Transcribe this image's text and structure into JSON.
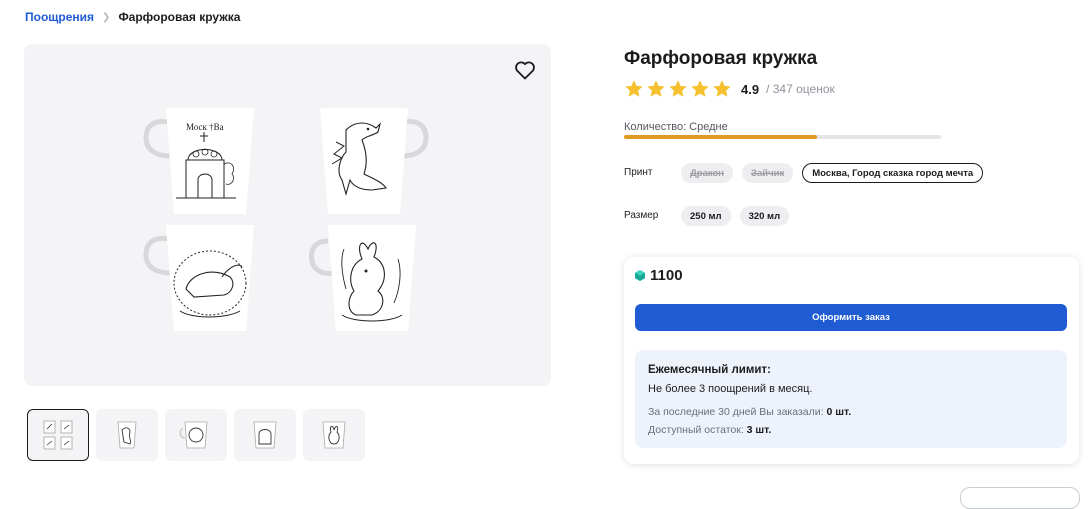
{
  "breadcrumb": {
    "parent": "Поощрения",
    "current": "Фарфоровая кружка"
  },
  "product": {
    "title": "Фарфоровая кружка",
    "rating": {
      "value": "4.9",
      "count_text": "/ 347 оценок",
      "stars": 5,
      "star_color": "#f5c12e"
    },
    "quantity": {
      "label": "Количество: Средне",
      "level": 0.61,
      "color": "#e09a22"
    },
    "print": {
      "label": "Принт",
      "options": [
        {
          "label": "Дракон",
          "state": "disabled"
        },
        {
          "label": "Зайчик",
          "state": "disabled"
        },
        {
          "label": "Москва, Город сказка город мечта",
          "state": "selected"
        }
      ]
    },
    "size": {
      "label": "Размер",
      "options": [
        {
          "label": "250 мл",
          "state": "available"
        },
        {
          "label": "320 мл",
          "state": "available"
        }
      ]
    }
  },
  "gallery": {
    "favorite_icon": "heart-icon",
    "thumbnail_count": 5,
    "active_thumbnail": 0
  },
  "order": {
    "currency_icon": "gem-icon",
    "price": "1100",
    "button_label": "Оформить заказ",
    "accent_color": "#1f5bd3",
    "limit": {
      "title": "Ежемесячный лимит:",
      "text": "Не более 3 поощрений в месяц.",
      "ordered_label": "За последние 30 дней Вы заказали:",
      "ordered_value": "0 шт.",
      "remaining_label": "Доступный остаток:",
      "remaining_value": "3 шт."
    }
  }
}
